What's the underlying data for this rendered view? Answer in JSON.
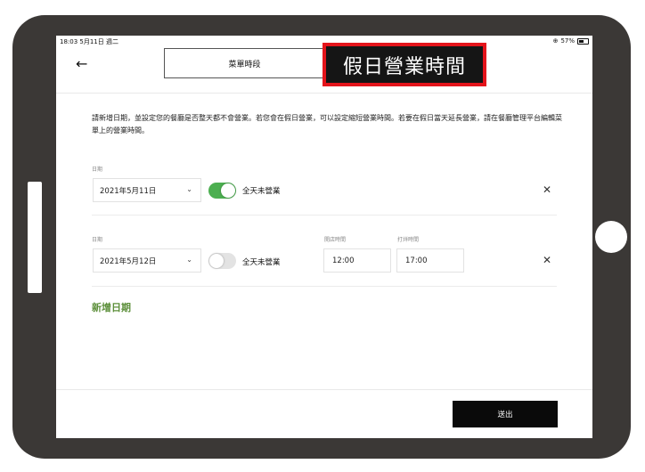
{
  "status_bar": {
    "time_date": "18:03  5月11日 週二",
    "battery_percent": "57%"
  },
  "header": {
    "back_icon": "arrow-left-icon",
    "tab_label": "菜單時段",
    "title": "假日營業時間",
    "title_border_color": "#e4141b"
  },
  "intro_text": "請新增日期，並設定您的餐廳是否整天都不會營業。若您會在假日營業，可以設定縮短營業時間。若要在假日當天延長營業，請在餐廳管理平台編輯菜單上的營業時間。",
  "rows": [
    {
      "date_label": "日期",
      "date_value": "2021年5月11日",
      "closed_all_day": true,
      "closed_label": "全天未營業"
    },
    {
      "date_label": "日期",
      "date_value": "2021年5月12日",
      "closed_all_day": false,
      "closed_label": "全天未營業",
      "open_label": "開店時間",
      "open_value": "12:00",
      "close_label": "打烊時間",
      "close_value": "17:00"
    }
  ],
  "add_date_label": "新增日期",
  "submit_label": "送出",
  "colors": {
    "toggle_on": "#4caf50",
    "add_link": "#5c8f3a",
    "submit_bg": "#0a0a0a"
  }
}
